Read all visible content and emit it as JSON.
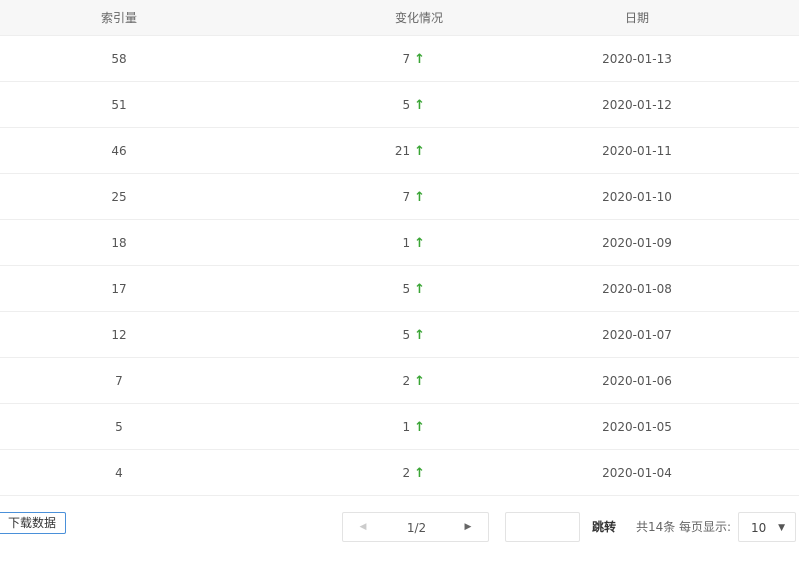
{
  "table": {
    "headers": [
      "索引量",
      "变化情况",
      "日期"
    ],
    "rows": [
      {
        "index": "58",
        "change": "7",
        "date": "2020-01-13"
      },
      {
        "index": "51",
        "change": "5",
        "date": "2020-01-12"
      },
      {
        "index": "46",
        "change": "21",
        "date": "2020-01-11"
      },
      {
        "index": "25",
        "change": "7",
        "date": "2020-01-10"
      },
      {
        "index": "18",
        "change": "1",
        "date": "2020-01-09"
      },
      {
        "index": "17",
        "change": "5",
        "date": "2020-01-08"
      },
      {
        "index": "12",
        "change": "5",
        "date": "2020-01-07"
      },
      {
        "index": "7",
        "change": "2",
        "date": "2020-01-06"
      },
      {
        "index": "5",
        "change": "1",
        "date": "2020-01-05"
      },
      {
        "index": "4",
        "change": "2",
        "date": "2020-01-04"
      }
    ],
    "trend_icon": "arrow-up-icon",
    "trend_color": "#3aa535"
  },
  "footer": {
    "download_label": "下载数据",
    "pagination": {
      "current_text": "1/2",
      "prev_icon": "caret-left-icon",
      "next_icon": "caret-right-icon"
    },
    "jump_input_value": "",
    "jump_label": "跳转",
    "total_label": "共14条",
    "per_page_label": "每页显示:",
    "per_page_value": "10",
    "per_page_icon": "caret-down-icon"
  },
  "colors": {
    "accent": "#4a90d9",
    "header_bg": "#f7f7f7",
    "border": "#eeeeee"
  }
}
